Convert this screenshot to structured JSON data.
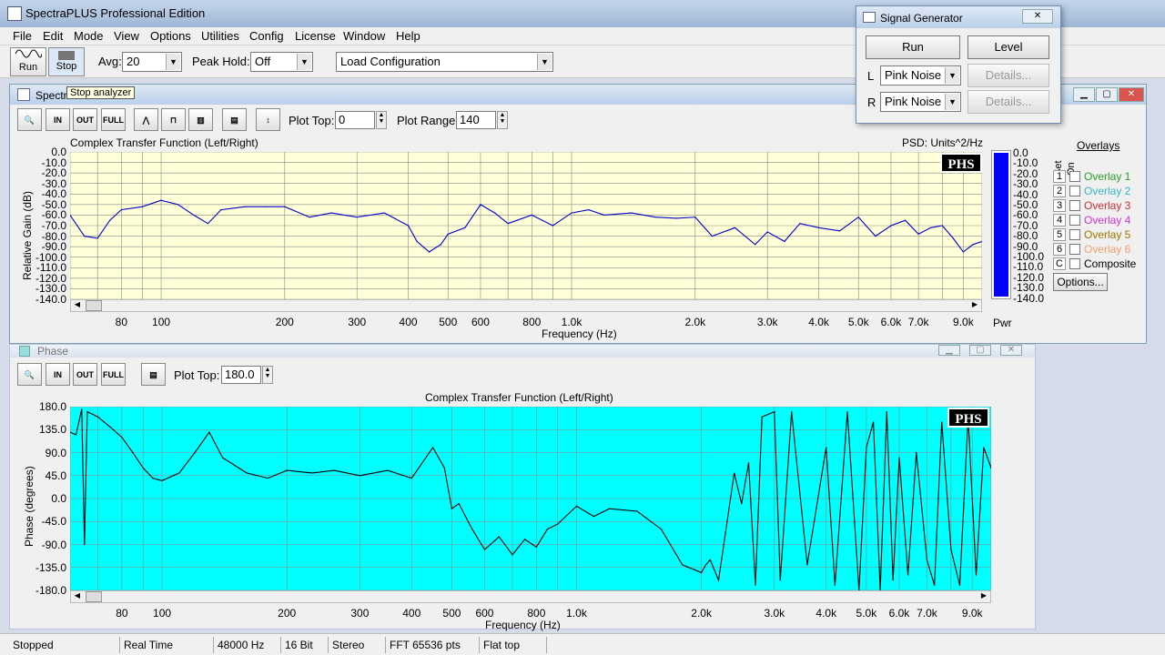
{
  "app": {
    "title": "SpectraPLUS Professional Edition"
  },
  "menu": [
    "File",
    "Edit",
    "Mode",
    "View",
    "Options",
    "Utilities",
    "Config",
    "License",
    "Window",
    "Help"
  ],
  "toolbar": {
    "run_label": "Run",
    "stop_label": "Stop",
    "avg_label": "Avg:",
    "avg_value": "20",
    "peak_label": "Peak Hold:",
    "peak_value": "Off",
    "load_config": "Load Configuration",
    "tooltip": "Stop analyzer"
  },
  "spectrum": {
    "window_title": "Spectrum",
    "plot_top_label": "Plot Top:",
    "plot_top_value": "0",
    "plot_range_label": "Plot Range:",
    "plot_range_value": "140",
    "title": "Complex Transfer Function (Left/Right)",
    "psd": "PSD: Units^2/Hz",
    "badge": "PHS",
    "ylabel": "Relative Gain (dB)",
    "xlabel": "Frequency (Hz)",
    "yticks": [
      "0.0",
      "-10.0",
      "-20.0",
      "-30.0",
      "-40.0",
      "-50.0",
      "-60.0",
      "-70.0",
      "-80.0",
      "-90.0",
      "-100.0",
      "-110.0",
      "-120.0",
      "-130.0",
      "-140.0"
    ],
    "pwr_label": "Pwr",
    "pwr_level": 1.0
  },
  "phase": {
    "window_title": "Phase",
    "plot_top_label": "Plot Top:",
    "plot_top_value": "180.0",
    "title": "Complex Transfer Function (Left/Right)",
    "badge": "PHS",
    "ylabel": "Phase (degrees)",
    "xlabel": "Frequency (Hz)",
    "yticks": [
      "180.0",
      "135.0",
      "90.0",
      "45.0",
      "0.0",
      "-45.0",
      "-90.0",
      "-135.0",
      "-180.0"
    ]
  },
  "xticks": [
    {
      "f": 80,
      "label": "80"
    },
    {
      "f": 100,
      "label": "100"
    },
    {
      "f": 200,
      "label": "200"
    },
    {
      "f": 300,
      "label": "300"
    },
    {
      "f": 400,
      "label": "400"
    },
    {
      "f": 500,
      "label": "500"
    },
    {
      "f": 600,
      "label": "600"
    },
    {
      "f": 800,
      "label": "800"
    },
    {
      "f": 1000,
      "label": "1.0k"
    },
    {
      "f": 2000,
      "label": "2.0k"
    },
    {
      "f": 3000,
      "label": "3.0k"
    },
    {
      "f": 4000,
      "label": "4.0k"
    },
    {
      "f": 5000,
      "label": "5.0k"
    },
    {
      "f": 6000,
      "label": "6.0k"
    },
    {
      "f": 7000,
      "label": "7.0k"
    },
    {
      "f": 9000,
      "label": "9.0k"
    }
  ],
  "overlays": {
    "header": "Overlays",
    "set_label": "Set",
    "on_label": "On",
    "items": [
      {
        "num": "1",
        "label": "Overlay 1",
        "color": "#2e9c2e"
      },
      {
        "num": "2",
        "label": "Overlay 2",
        "color": "#3cb4c8"
      },
      {
        "num": "3",
        "label": "Overlay 3",
        "color": "#c83232"
      },
      {
        "num": "4",
        "label": "Overlay 4",
        "color": "#d232d2"
      },
      {
        "num": "5",
        "label": "Overlay 5",
        "color": "#a07800"
      },
      {
        "num": "6",
        "label": "Overlay 6",
        "color": "#f0a070"
      },
      {
        "num": "C",
        "label": "Composite",
        "color": "#000000"
      }
    ],
    "options_label": "Options..."
  },
  "siggen": {
    "title": "Signal Generator",
    "run": "Run",
    "level": "Level",
    "l": "L",
    "r": "R",
    "l_value": "Pink Noise",
    "r_value": "Pink Noise",
    "details": "Details..."
  },
  "status": [
    "Stopped",
    "Real Time",
    "48000 Hz",
    "16 Bit",
    "Stereo",
    "FFT 65536 pts",
    "Flat top"
  ],
  "colors": {
    "spectrum_bg": "#ffffd8",
    "phase_bg": "#00ffff",
    "trace": "#0000c8",
    "phase_trace": "#000000",
    "pwr_bar": "#0000ff"
  },
  "chart_data": [
    {
      "type": "line",
      "title": "Complex Transfer Function (Left/Right)",
      "xlabel": "Frequency (Hz)",
      "ylabel": "Relative Gain (dB)",
      "xscale": "log",
      "xlim": [
        60,
        10000
      ],
      "ylim": [
        -140,
        0
      ],
      "grid": true,
      "series": [
        {
          "x": [
            60,
            65,
            70,
            75,
            80,
            90,
            100,
            110,
            120,
            130,
            140,
            160,
            180,
            200,
            230,
            260,
            300,
            350,
            400,
            420,
            450,
            480,
            500,
            550,
            600,
            650,
            700,
            800,
            900,
            1000,
            1100,
            1200,
            1400,
            1600,
            1800,
            2000,
            2200,
            2500,
            2800,
            3000,
            3300,
            3600,
            4000,
            4500,
            5000,
            5500,
            6000,
            6500,
            7000,
            7500,
            8000,
            8500,
            9000,
            9500,
            10000
          ],
          "y": [
            -60,
            -80,
            -82,
            -65,
            -55,
            -52,
            -46,
            -50,
            -60,
            -68,
            -55,
            -52,
            -52,
            -52,
            -62,
            -58,
            -62,
            -58,
            -70,
            -85,
            -95,
            -88,
            -78,
            -72,
            -50,
            -58,
            -68,
            -60,
            -70,
            -58,
            -55,
            -60,
            -58,
            -62,
            -63,
            -62,
            -80,
            -72,
            -88,
            -76,
            -85,
            -68,
            -72,
            -75,
            -62,
            -80,
            -70,
            -65,
            -78,
            -72,
            -70,
            -82,
            -95,
            -88,
            -85
          ]
        }
      ]
    },
    {
      "type": "line",
      "title": "Complex Transfer Function (Left/Right)",
      "xlabel": "Frequency (Hz)",
      "ylabel": "Phase (degrees)",
      "xscale": "log",
      "xlim": [
        60,
        10000
      ],
      "ylim": [
        -180,
        180
      ],
      "grid": true,
      "series": [
        {
          "x": [
            60,
            62,
            64,
            65,
            66,
            68,
            70,
            75,
            80,
            85,
            90,
            95,
            100,
            110,
            120,
            130,
            140,
            160,
            180,
            200,
            230,
            260,
            300,
            350,
            400,
            450,
            480,
            500,
            520,
            560,
            600,
            650,
            700,
            750,
            800,
            850,
            900,
            1000,
            1100,
            1200,
            1400,
            1600,
            1800,
            2000,
            2050,
            2100,
            2200,
            2400,
            2500,
            2600,
            2700,
            2800,
            3000,
            3100,
            3300,
            3600,
            4000,
            4200,
            4500,
            4800,
            5000,
            5200,
            5400,
            5600,
            5800,
            6000,
            6300,
            6600,
            7000,
            7300,
            7600,
            8000,
            8400,
            8800,
            9200,
            9600,
            10000
          ],
          "y": [
            130,
            125,
            175,
            -90,
            170,
            165,
            160,
            140,
            120,
            90,
            60,
            40,
            35,
            50,
            90,
            130,
            80,
            50,
            40,
            55,
            50,
            55,
            45,
            55,
            40,
            100,
            60,
            -20,
            -10,
            -60,
            -100,
            -75,
            -110,
            -80,
            -95,
            -60,
            -50,
            -15,
            -35,
            -20,
            -25,
            -60,
            -130,
            -145,
            -130,
            -120,
            -160,
            50,
            -10,
            70,
            -170,
            160,
            170,
            -160,
            170,
            -130,
            100,
            -170,
            170,
            -180,
            100,
            150,
            -180,
            170,
            -160,
            80,
            -150,
            90,
            -120,
            -170,
            150,
            -100,
            -170,
            160,
            -150,
            100,
            60
          ]
        }
      ]
    }
  ]
}
